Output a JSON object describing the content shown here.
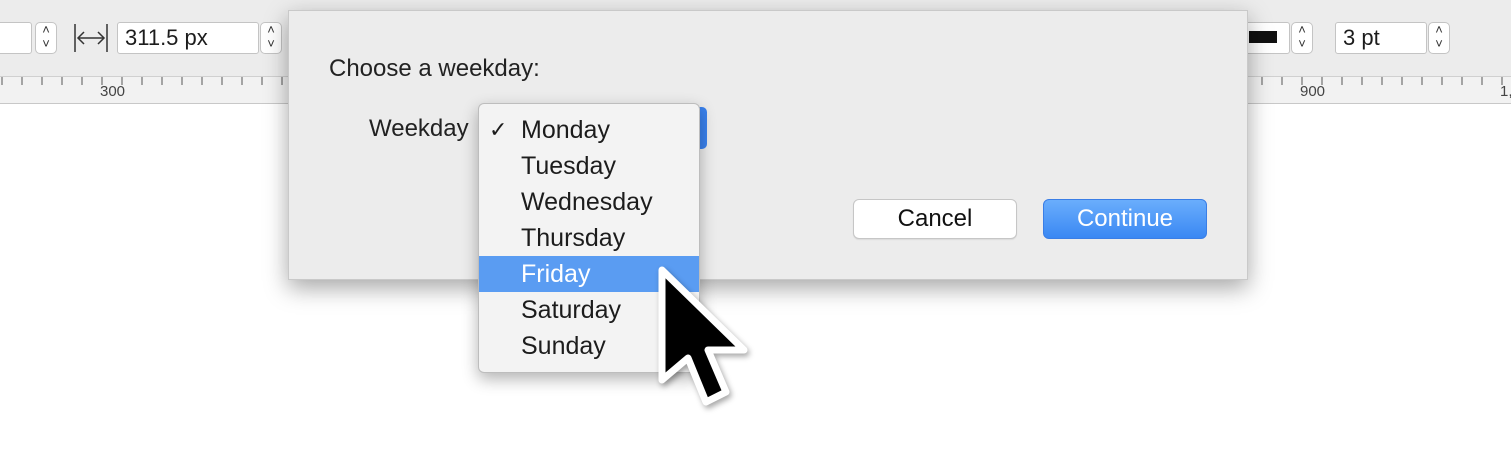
{
  "toolbar": {
    "left_field_value": "",
    "width_value": "311.5 px",
    "stroke_width_value": "3 pt",
    "stroke_color": "#111111",
    "icons": [
      "stepper-icon",
      "width-arrows-icon"
    ]
  },
  "ruler": {
    "labels": [
      "300",
      "900",
      "1,"
    ]
  },
  "dialog": {
    "title": "Choose a weekday:",
    "weekday_label": "Weekday",
    "cancel_label": "Cancel",
    "continue_label": "Continue",
    "accent_color": "#3a88f3"
  },
  "menu": {
    "checkmark": "✓",
    "items": [
      "Monday",
      "Tuesday",
      "Wednesday",
      "Thursday",
      "Friday",
      "Saturday",
      "Sunday"
    ],
    "selected": "Monday",
    "highlighted": "Friday",
    "highlight_color": "#5a9cf2"
  }
}
